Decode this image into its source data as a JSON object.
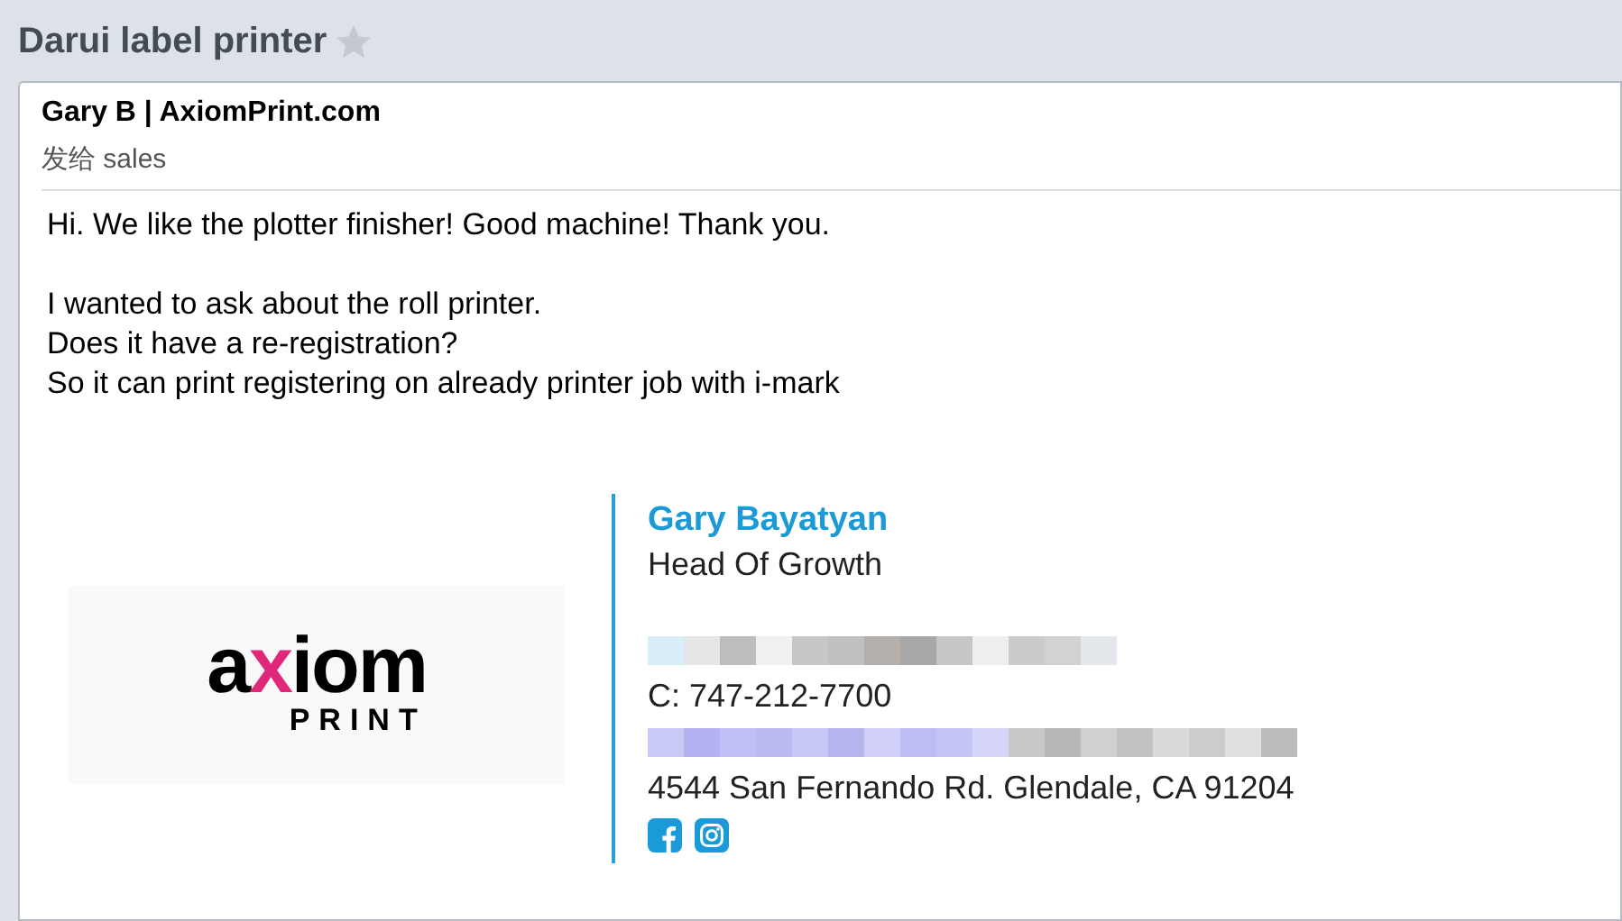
{
  "thread": {
    "title": "Darui label printer",
    "starred": false
  },
  "message": {
    "sender": "Gary B | AxiomPrint.com",
    "recipient": "发给 sales",
    "paragraphs": [
      [
        "Hi. We like the plotter finisher! Good machine! Thank you."
      ],
      [
        "I wanted to ask about the roll printer.",
        "Does it have a re-registration?",
        "So it can print registering on already printer job with i-mark"
      ]
    ],
    "signature": {
      "logo": {
        "wordmark": "axiom",
        "subtitle": "PRINT"
      },
      "name": "Gary Bayatyan",
      "role": "Head Of Growth",
      "lines": [
        {
          "kind": "redacted"
        },
        {
          "kind": "text",
          "text": "C: 747-212-7700"
        },
        {
          "kind": "redacted-link"
        },
        {
          "kind": "text",
          "text": "4544 San Fernando Rd. Glendale, CA 91204"
        }
      ]
    }
  }
}
